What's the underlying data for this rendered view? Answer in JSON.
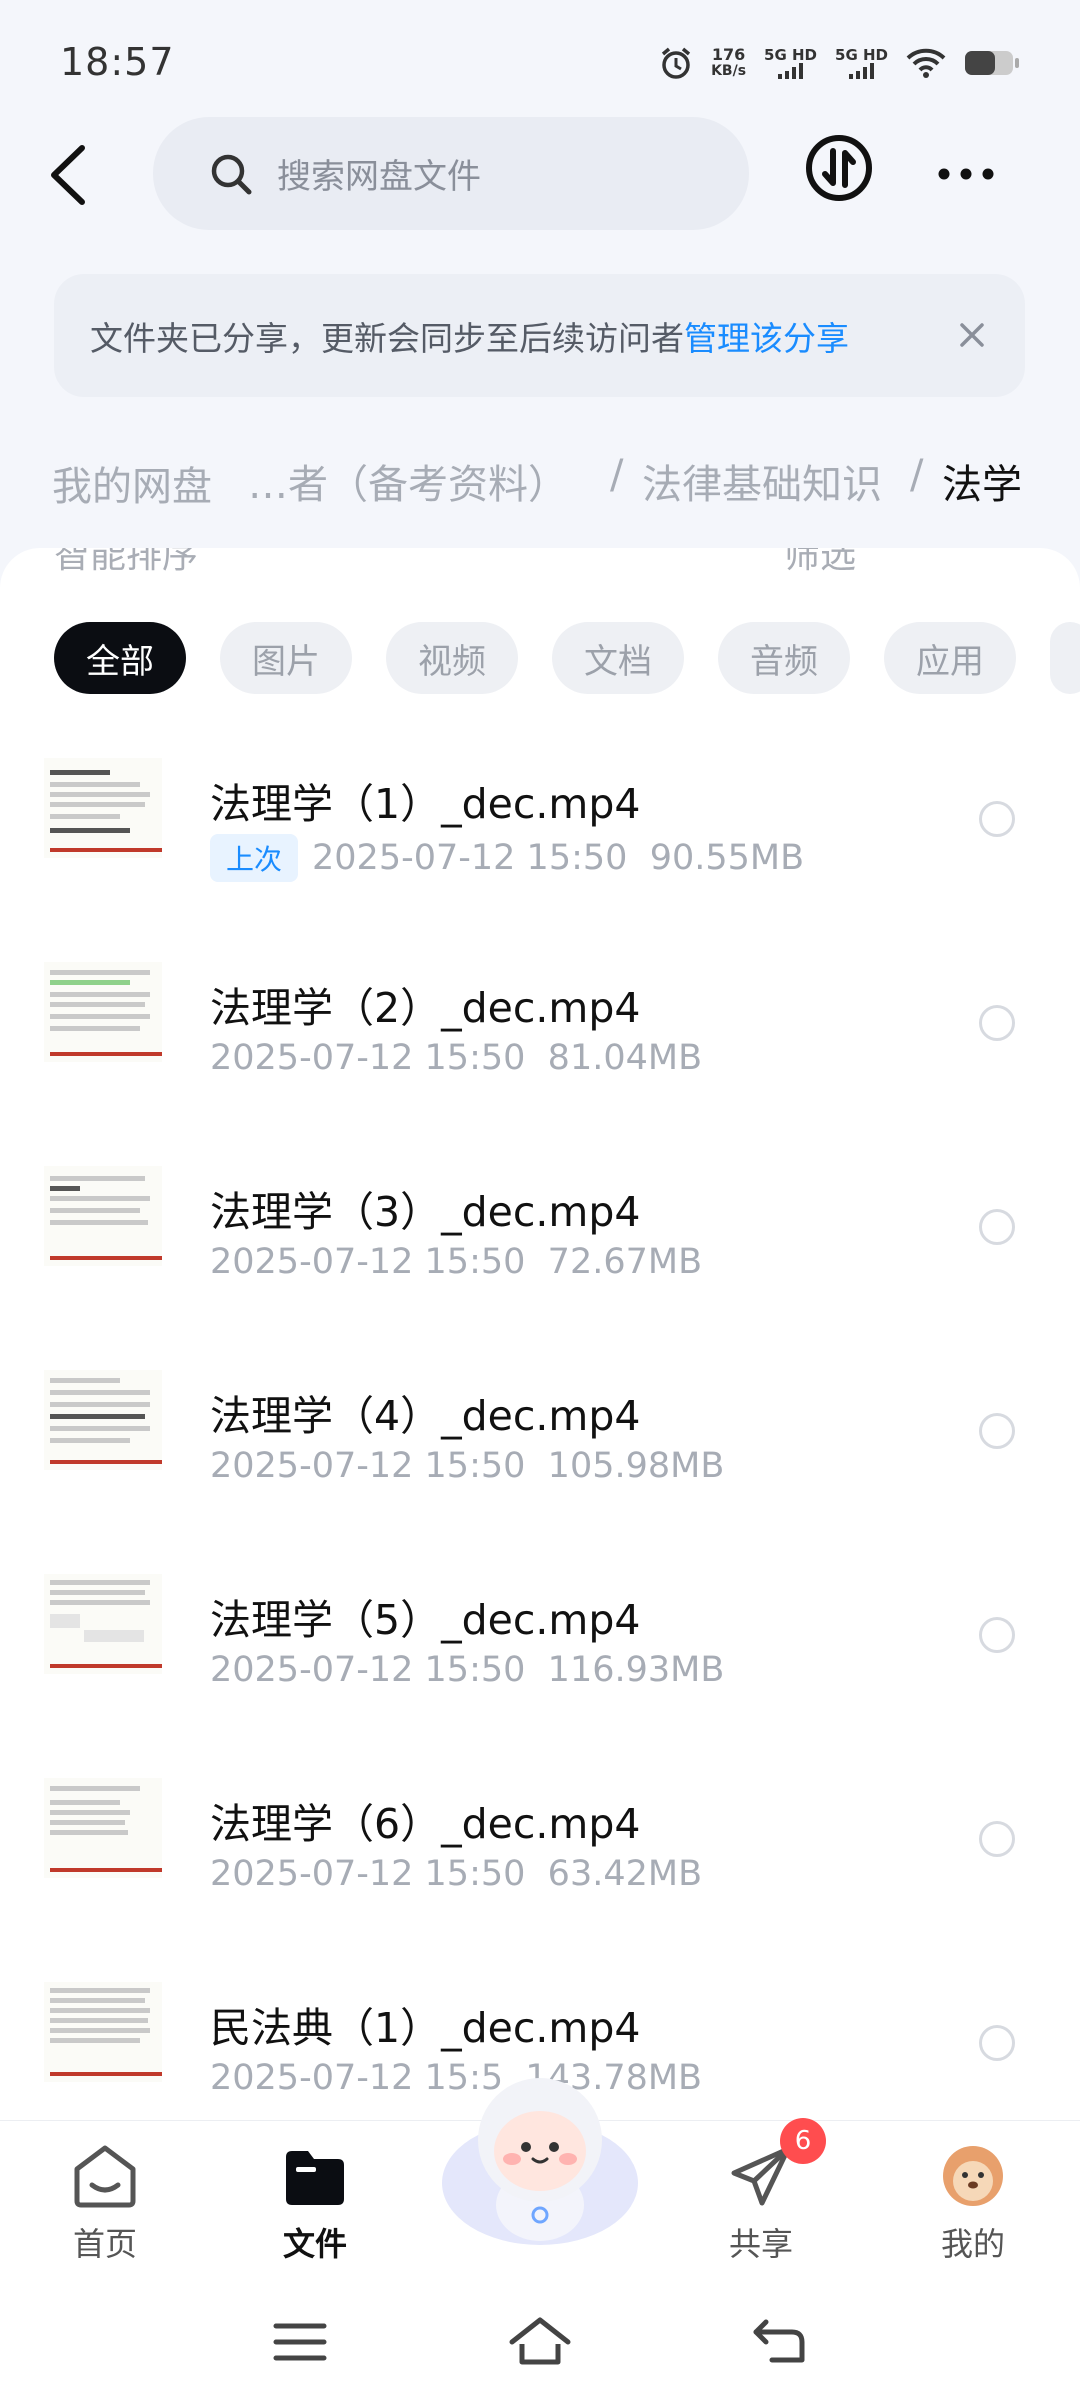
{
  "status_bar": {
    "time": "18:57",
    "net_speed_value": "176",
    "net_speed_unit": "KB/s",
    "sim1": "5G HD",
    "sim2": "5G HD"
  },
  "search": {
    "placeholder": "搜索网盘文件"
  },
  "banner": {
    "text": "文件夹已分享，更新会同步至后续访问者",
    "link": "管理该分享"
  },
  "breadcrumb": {
    "home": "我的网盘",
    "middle": "…者（备考资料）",
    "sep1": "/",
    "parent": "法律基础知识",
    "sep2": "/",
    "current": "法学"
  },
  "sort_bar": {
    "sort_label": "智能排序",
    "filter_label": "筛选"
  },
  "chips": [
    "全部",
    "图片",
    "视频",
    "文档",
    "音频",
    "应用"
  ],
  "files": [
    {
      "name": "法理学（1）_dec.mp4",
      "tag": "上次",
      "date": "2025-07-12  15:50",
      "size": "90.55MB"
    },
    {
      "name": "法理学（2）_dec.mp4",
      "tag": "",
      "date": "2025-07-12  15:50",
      "size": "81.04MB"
    },
    {
      "name": "法理学（3）_dec.mp4",
      "tag": "",
      "date": "2025-07-12  15:50",
      "size": "72.67MB"
    },
    {
      "name": "法理学（4）_dec.mp4",
      "tag": "",
      "date": "2025-07-12  15:50",
      "size": "105.98MB"
    },
    {
      "name": "法理学（5）_dec.mp4",
      "tag": "",
      "date": "2025-07-12  15:50",
      "size": "116.93MB"
    },
    {
      "name": "法理学（6）_dec.mp4",
      "tag": "",
      "date": "2025-07-12  15:50",
      "size": "63.42MB"
    },
    {
      "name": "民法典（1）_dec.mp4",
      "tag": "",
      "date": "2025-07-12  15:5",
      "size": "143.78MB"
    }
  ],
  "bottom_nav": {
    "home": "首页",
    "files": "文件",
    "share": "共享",
    "share_badge": "6",
    "me": "我的"
  },
  "colors": {
    "accent": "#1a8cff",
    "active_chip": "#0b0d12",
    "badge": "#ff4d4f"
  }
}
